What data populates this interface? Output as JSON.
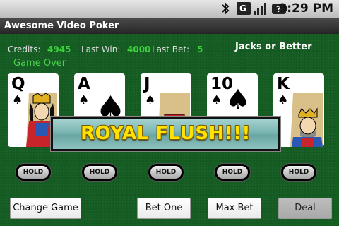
{
  "status_bar": {
    "time": "9:29 PM",
    "icons": [
      "bluetooth-icon",
      "network-type-icon",
      "signal-strength-icon",
      "battery-charging-icon"
    ]
  },
  "app": {
    "title": "Awesome Video Poker"
  },
  "stats": {
    "credits_label": "Credits:",
    "credits_value": "4945",
    "last_win_label": "Last Win:",
    "last_win_value": "4000",
    "last_bet_label": "Last Bet:",
    "last_bet_value": "5"
  },
  "game_mode": "Jacks or Better",
  "game_status": "Game Over",
  "hand": [
    {
      "rank": "Q",
      "suit": "♠",
      "suit_name": "spades"
    },
    {
      "rank": "A",
      "suit": "♠",
      "suit_name": "spades"
    },
    {
      "rank": "J",
      "suit": "♠",
      "suit_name": "spades"
    },
    {
      "rank": "10",
      "suit": "♠",
      "suit_name": "spades"
    },
    {
      "rank": "K",
      "suit": "♠",
      "suit_name": "spades"
    }
  ],
  "result_banner": "ROYAL FLUSH!!!",
  "hold_label": "HOLD",
  "buttons": {
    "change_game": "Change Game",
    "bet_one": "Bet One",
    "max_bet": "Max Bet",
    "deal": "Deal"
  },
  "colors": {
    "felt": "#145c22",
    "stat_value": "#3bd23b",
    "banner_text": "#ffe200",
    "banner_bg": "#7ab5b2"
  }
}
